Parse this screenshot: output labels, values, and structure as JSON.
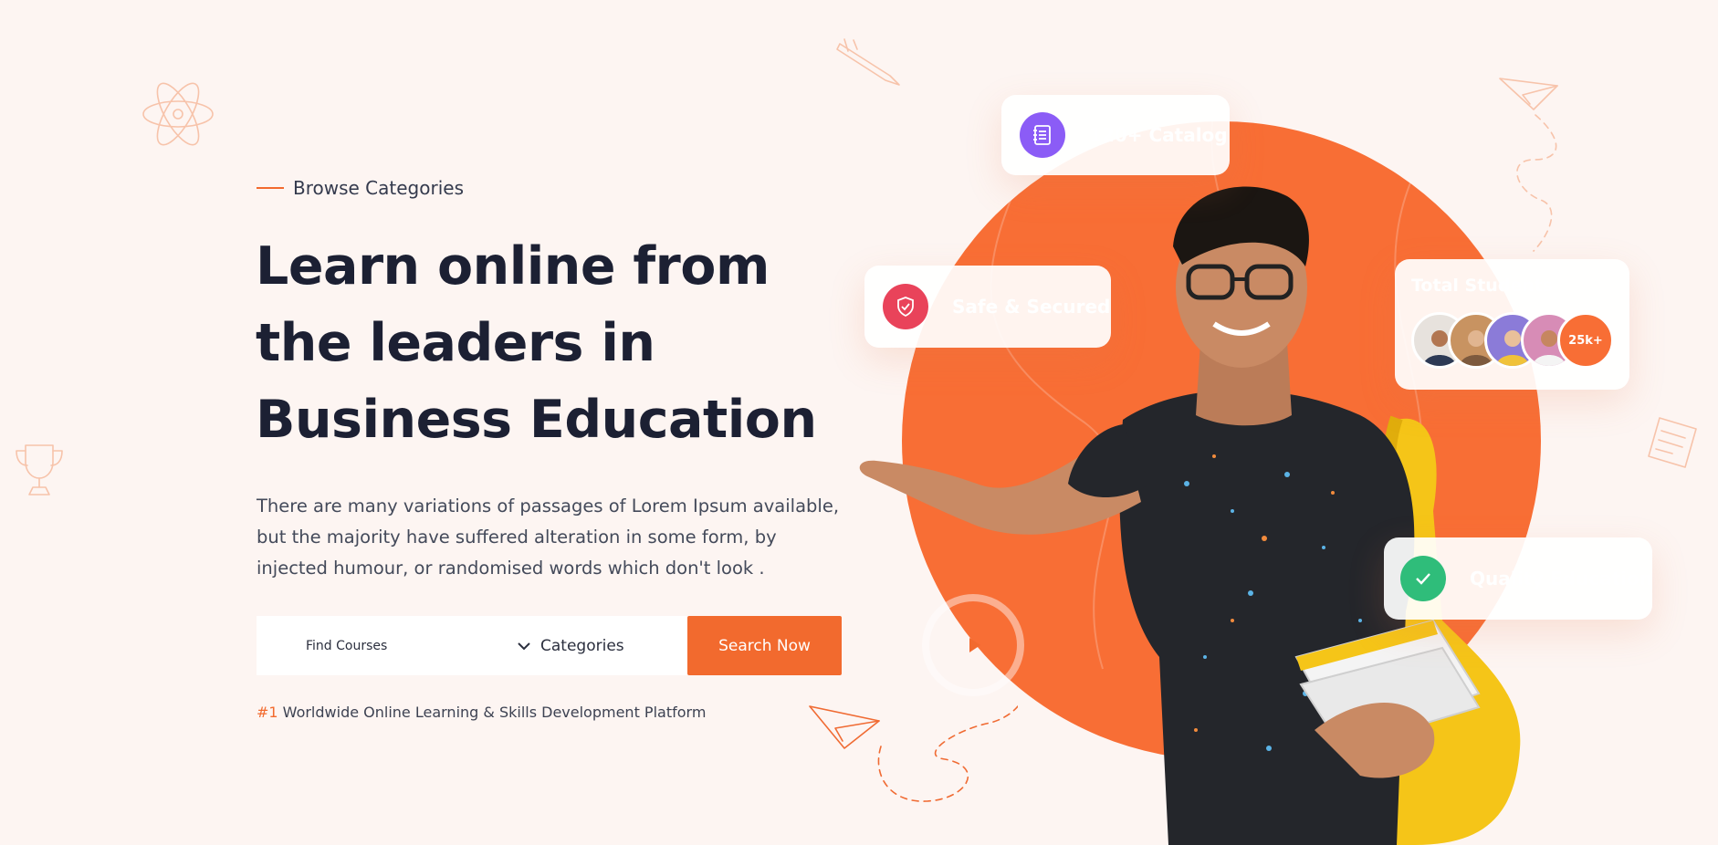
{
  "hero": {
    "eyebrow": "Browse Categories",
    "title": "Learn online from the leaders in Business Education",
    "description": "There are many variations of passages of Lorem Ipsum available, but the majority have suffered alteration in some form, by injected humour, or randomised words which don't look .",
    "tagline_hash": "#1",
    "tagline_text": " Worldwide Online Learning & Skills Development Platform"
  },
  "search": {
    "placeholder": "Find Courses",
    "category_label": "Categories",
    "button_label": "Search Now"
  },
  "cards": {
    "catalog": {
      "label": "120+ Catalog",
      "icon": "notebook-icon",
      "color": "#8b5cf6"
    },
    "safe": {
      "label": "Safe & Secured",
      "icon": "shield-check-icon",
      "color": "#e9435a"
    },
    "students": {
      "label": "Total Students",
      "count": "25k+"
    },
    "quality": {
      "label": "Quality Education",
      "icon": "check-icon",
      "color": "#2fbd7a"
    }
  },
  "colors": {
    "accent": "#f26a2e",
    "circle": "#f86e35",
    "background": "#fdf5f2",
    "heading": "#1c2033"
  }
}
